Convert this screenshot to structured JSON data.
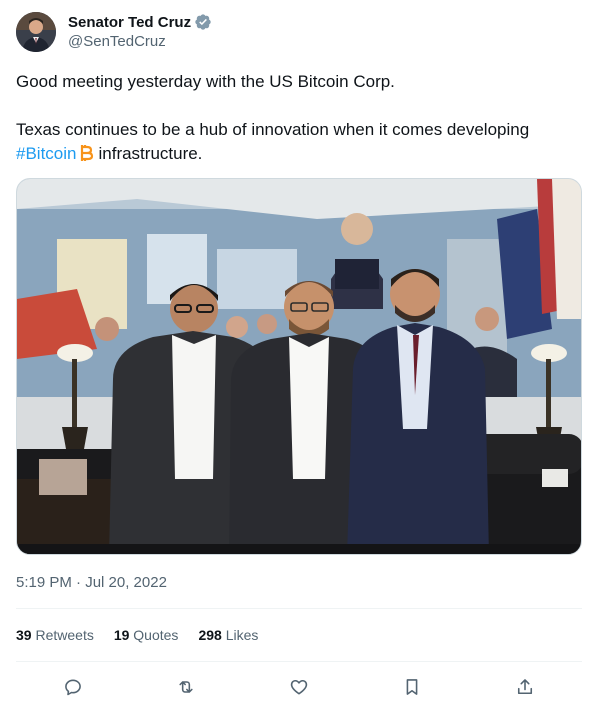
{
  "author": {
    "display_name": "Senator Ted Cruz",
    "handle": "@SenTedCruz",
    "verified_icon": "verified-badge-icon",
    "verified_color": "#829aab"
  },
  "tweet": {
    "line1": "Good meeting yesterday with the US Bitcoin Corp.",
    "line2_prefix": "Texas continues to be a hub of innovation when it comes developing",
    "hashtag": "#Bitcoin",
    "line3_suffix": "infrastructure.",
    "hashtag_color": "#1d9bf0",
    "bitcoin_emoji_color": "#f7931a"
  },
  "media": {
    "description_icon": "photo"
  },
  "timestamp": "5:19 PM · Jul 20, 2022",
  "stats": {
    "retweets_count": "39",
    "retweets_label": "Retweets",
    "quotes_count": "19",
    "quotes_label": "Quotes",
    "likes_count": "298",
    "likes_label": "Likes"
  },
  "actions": [
    "reply-icon",
    "retweet-icon",
    "like-icon",
    "bookmark-icon",
    "share-icon"
  ]
}
